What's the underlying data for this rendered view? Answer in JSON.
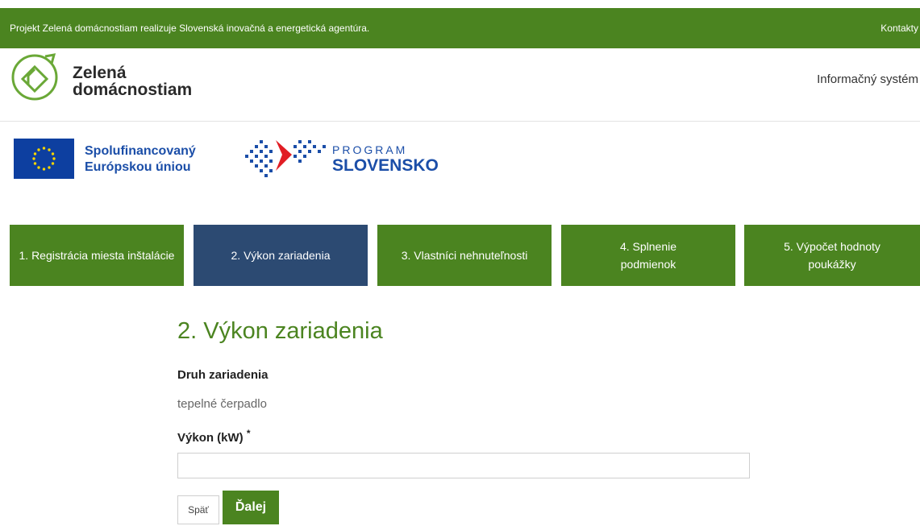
{
  "topbar": {
    "notice": "Projekt Zelená domácnostiam realizuje Slovenská inovačná a energetická agentúra.",
    "contacts": "Kontakty"
  },
  "brand": {
    "line1": "Zelená",
    "line2": "domácnostiam",
    "system": "Informačný systém"
  },
  "partners": {
    "eu_line1": "Spolufinancovaný",
    "eu_line2": "Európskou úniou",
    "program_line1": "PROGRAM",
    "program_line2": "SLOVENSKO"
  },
  "steps": [
    {
      "label": "1. Registrácia miesta inštalácie",
      "active": false
    },
    {
      "label": "2. Výkon zariadenia",
      "active": true
    },
    {
      "label": "3. Vlastníci nehnuteľnosti",
      "active": false
    },
    {
      "label": "4. Splnenie podmienok",
      "active": false
    },
    {
      "label": "5. Výpočet hodnoty poukážky",
      "active": false
    }
  ],
  "form": {
    "title": "2. Výkon zariadenia",
    "device_type_label": "Druh zariadenia",
    "device_type_value": "tepelné čerpadlo",
    "power_label": "Výkon (kW)",
    "required_mark": "*",
    "power_value": "",
    "back_button": "Späť",
    "next_button": "Ďalej"
  },
  "colors": {
    "green": "#4b8420",
    "active_step": "#2c4a72",
    "eu_blue": "#0d3fa0",
    "program_blue": "#1b4ea8",
    "program_red": "#e11d24"
  }
}
